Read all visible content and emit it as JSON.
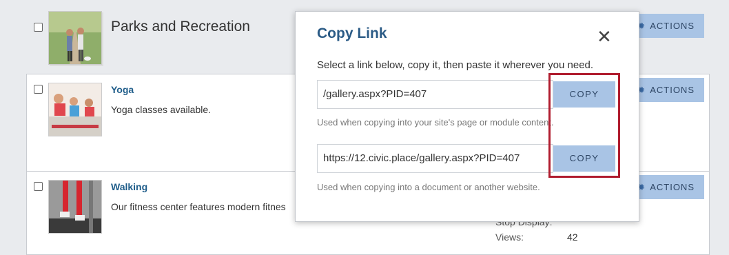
{
  "list": {
    "rows": [
      {
        "title": "Parks and Recreation",
        "actions_label": "ACTIONS"
      },
      {
        "title": "Yoga",
        "description": "Yoga classes available.",
        "actions_label": "ACTIONS"
      },
      {
        "title": "Walking",
        "description": "Our fitness center features modern fitnes",
        "actions_label": "ACTIONS"
      }
    ],
    "meta": {
      "stop_display_label": "Stop Display:",
      "views_label": "Views:",
      "views_value": "42"
    }
  },
  "modal": {
    "title": "Copy Link",
    "close_icon": "close-icon",
    "instructions": "Select a link below, copy it, then paste it wherever you need.",
    "links": [
      {
        "value": "/gallery.aspx?PID=407",
        "copy_label": "COPY",
        "help": "Used when copying into your site's page or module content."
      },
      {
        "value": "https://12.civic.place/gallery.aspx?PID=407",
        "copy_label": "COPY",
        "help": "Used when copying into a document or another website."
      }
    ]
  },
  "colors": {
    "accent_button": "#a9c4e5",
    "title_blue": "#2b5b86",
    "highlight_red": "#b01c2e"
  }
}
